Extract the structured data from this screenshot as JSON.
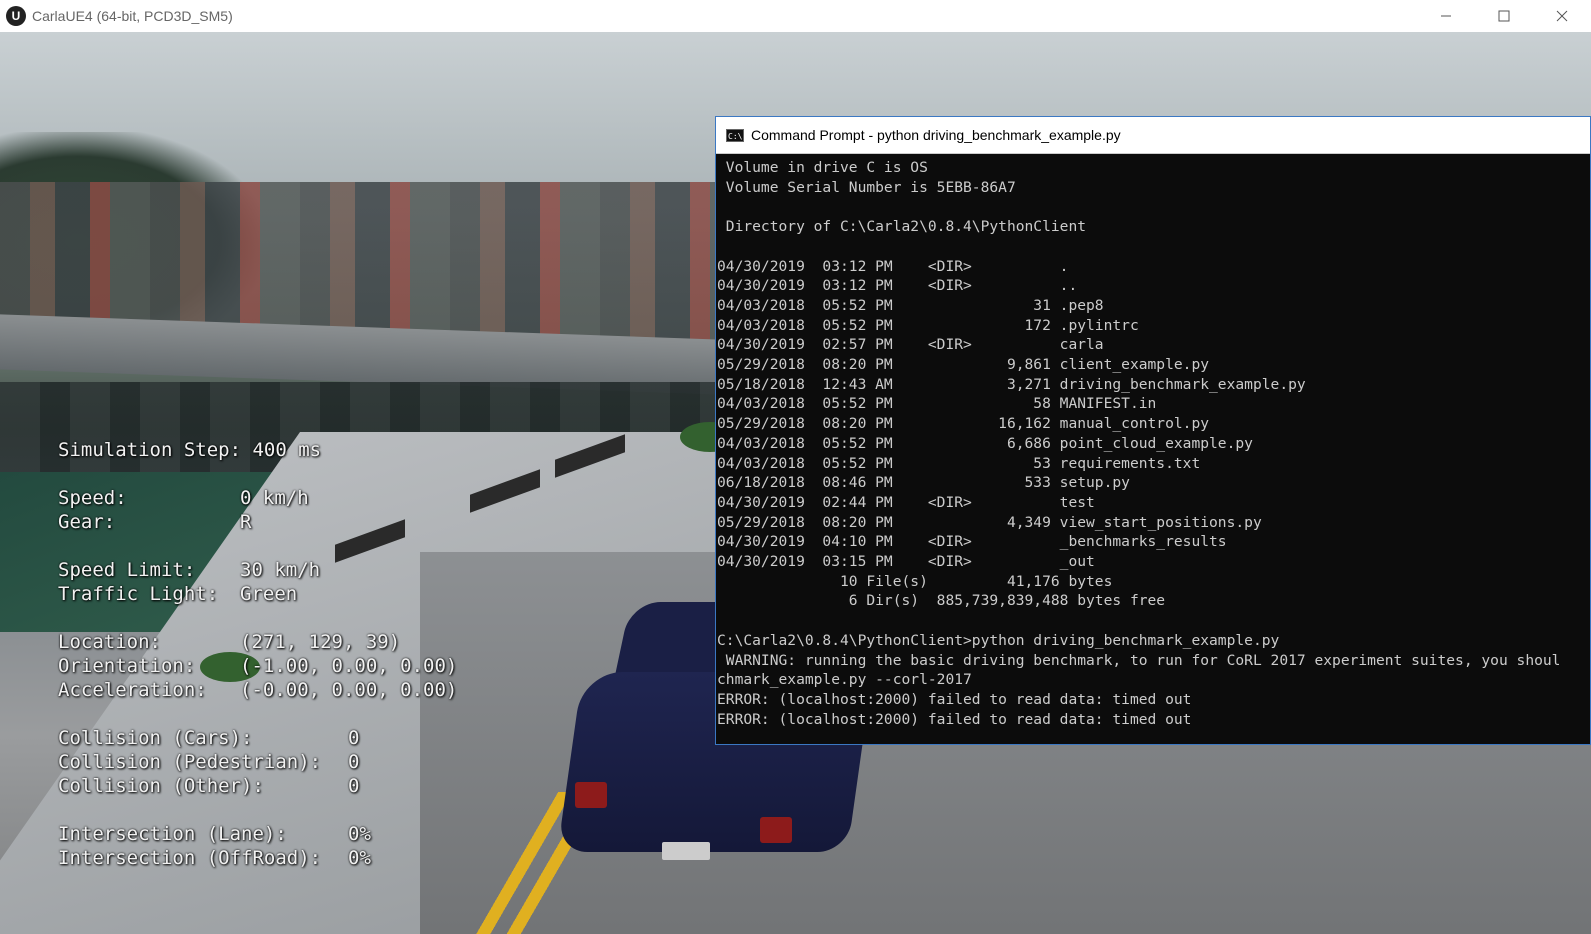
{
  "window": {
    "title": "CarlaUE4 (64-bit, PCD3D_SM5)",
    "logo": "U"
  },
  "hud": {
    "sim_step_label": "Simulation Step:",
    "sim_step_value": "400 ms",
    "speed_label": "Speed:",
    "speed_value": "0 km/h",
    "gear_label": "Gear:",
    "gear_value": "R",
    "speed_limit_label": "Speed Limit:",
    "speed_limit_value": "30 km/h",
    "traffic_light_label": "Traffic Light:",
    "traffic_light_value": "Green",
    "location_label": "Location:",
    "location_value": "(271, 129, 39)",
    "orientation_label": "Orientation:",
    "orientation_value": "(-1.00, 0.00, 0.00)",
    "acceleration_label": "Acceleration:",
    "acceleration_value": "(-0.00, 0.00, 0.00)",
    "coll_cars_label": "Collision (Cars):",
    "coll_cars_value": "0",
    "coll_ped_label": "Collision (Pedestrian):",
    "coll_ped_value": "0",
    "coll_other_label": "Collision (Other):",
    "coll_other_value": "0",
    "inter_lane_label": "Intersection (Lane):",
    "inter_lane_value": "0%",
    "inter_off_label": "Intersection (OffRoad):",
    "inter_off_value": "0%"
  },
  "cmd": {
    "title": "Command Prompt - python  driving_benchmark_example.py",
    "icon_text": "C:\\",
    "lines": [
      " Volume in drive C is OS",
      " Volume Serial Number is 5EBB-86A7",
      "",
      " Directory of C:\\Carla2\\0.8.4\\PythonClient",
      "",
      "04/30/2019  03:12 PM    <DIR>          .",
      "04/30/2019  03:12 PM    <DIR>          ..",
      "04/03/2018  05:52 PM                31 .pep8",
      "04/03/2018  05:52 PM               172 .pylintrc",
      "04/30/2019  02:57 PM    <DIR>          carla",
      "05/29/2018  08:20 PM             9,861 client_example.py",
      "05/18/2018  12:43 AM             3,271 driving_benchmark_example.py",
      "04/03/2018  05:52 PM                58 MANIFEST.in",
      "05/29/2018  08:20 PM            16,162 manual_control.py",
      "04/03/2018  05:52 PM             6,686 point_cloud_example.py",
      "04/03/2018  05:52 PM                53 requirements.txt",
      "06/18/2018  08:46 PM               533 setup.py",
      "04/30/2019  02:44 PM    <DIR>          test",
      "05/29/2018  08:20 PM             4,349 view_start_positions.py",
      "04/30/2019  04:10 PM    <DIR>          _benchmarks_results",
      "04/30/2019  03:15 PM    <DIR>          _out",
      "              10 File(s)         41,176 bytes",
      "               6 Dir(s)  885,739,839,488 bytes free",
      "",
      "C:\\Carla2\\0.8.4\\PythonClient>python driving_benchmark_example.py",
      " WARNING: running the basic driving benchmark, to run for CoRL 2017 experiment suites, you shoul",
      "chmark_example.py --corl-2017",
      "ERROR: (localhost:2000) failed to read data: timed out",
      "ERROR: (localhost:2000) failed to read data: timed out"
    ]
  }
}
